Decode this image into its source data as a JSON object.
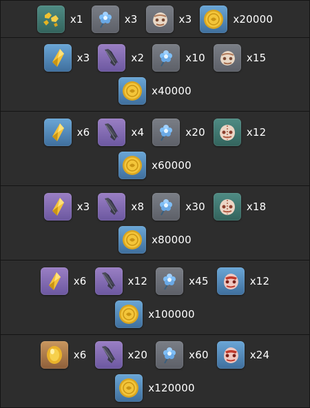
{
  "tiers": [
    {
      "rows": [
        [
          {
            "icon": "gold-nuggets-icon",
            "bg": "green",
            "qty": "x1"
          },
          {
            "icon": "blue-flower-icon",
            "bg": "gray",
            "qty": "x3"
          },
          {
            "icon": "pale-mask-icon",
            "bg": "gray",
            "qty": "x3"
          },
          {
            "icon": "mora-coin-icon",
            "bg": "blue",
            "qty": "x20000"
          }
        ]
      ]
    },
    {
      "rows": [
        [
          {
            "icon": "gold-crystal-icon",
            "bg": "blue",
            "qty": "x3"
          },
          {
            "icon": "dark-horn-icon",
            "bg": "purple",
            "qty": "x2"
          },
          {
            "icon": "blue-flower-icon",
            "bg": "gray",
            "qty": "x10"
          },
          {
            "icon": "pale-mask-icon",
            "bg": "gray",
            "qty": "x15"
          }
        ],
        [
          {
            "icon": "mora-coin-icon",
            "bg": "blue",
            "qty": "x40000"
          }
        ]
      ]
    },
    {
      "rows": [
        [
          {
            "icon": "gold-crystal-icon",
            "bg": "blue",
            "qty": "x6"
          },
          {
            "icon": "dark-horn-icon",
            "bg": "purple",
            "qty": "x4"
          },
          {
            "icon": "blue-flower-icon",
            "bg": "gray",
            "qty": "x20"
          },
          {
            "icon": "stitched-mask-icon",
            "bg": "green",
            "qty": "x12"
          }
        ],
        [
          {
            "icon": "mora-coin-icon",
            "bg": "blue",
            "qty": "x60000"
          }
        ]
      ]
    },
    {
      "rows": [
        [
          {
            "icon": "gold-crystal-icon",
            "bg": "purple",
            "qty": "x3"
          },
          {
            "icon": "dark-horn-icon",
            "bg": "purple",
            "qty": "x8"
          },
          {
            "icon": "blue-flower-icon",
            "bg": "gray",
            "qty": "x30"
          },
          {
            "icon": "stitched-mask-icon",
            "bg": "green",
            "qty": "x18"
          }
        ],
        [
          {
            "icon": "mora-coin-icon",
            "bg": "blue",
            "qty": "x80000"
          }
        ]
      ]
    },
    {
      "rows": [
        [
          {
            "icon": "gold-crystal-icon",
            "bg": "purple",
            "qty": "x6"
          },
          {
            "icon": "dark-horn-icon",
            "bg": "purple",
            "qty": "x12"
          },
          {
            "icon": "blue-flower-icon",
            "bg": "gray",
            "qty": "x45"
          },
          {
            "icon": "red-mask-icon",
            "bg": "blue",
            "qty": "x12"
          }
        ],
        [
          {
            "icon": "mora-coin-icon",
            "bg": "blue",
            "qty": "x100000"
          }
        ]
      ]
    },
    {
      "rows": [
        [
          {
            "icon": "gold-gem-icon",
            "bg": "orange",
            "qty": "x6"
          },
          {
            "icon": "dark-horn-icon",
            "bg": "purple",
            "qty": "x20"
          },
          {
            "icon": "blue-flower-icon",
            "bg": "gray",
            "qty": "x60"
          },
          {
            "icon": "red-mask-icon",
            "bg": "blue",
            "qty": "x24"
          }
        ],
        [
          {
            "icon": "mora-coin-icon",
            "bg": "blue",
            "qty": "x120000"
          }
        ]
      ]
    }
  ]
}
